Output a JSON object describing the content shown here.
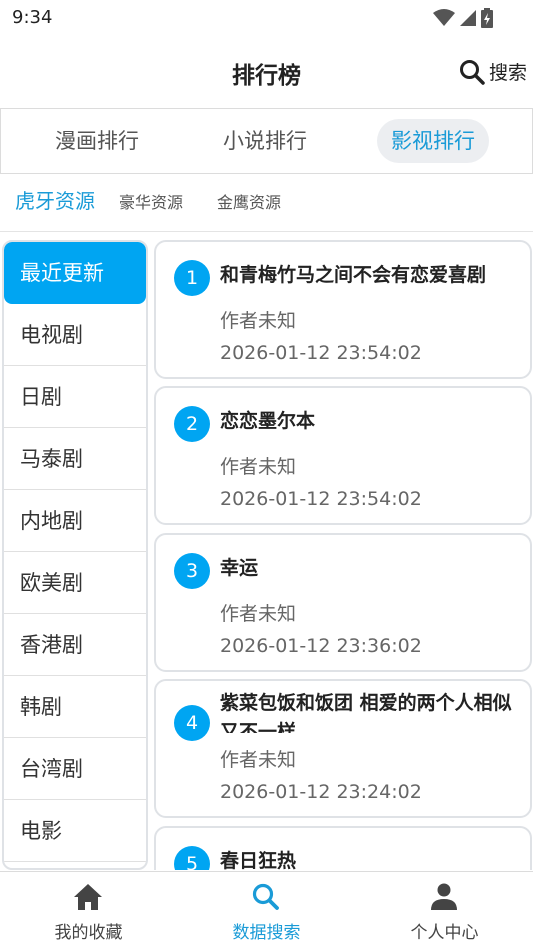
{
  "status_bar": {
    "time": "9:34"
  },
  "header": {
    "title": "排行榜",
    "search_label": "搜索"
  },
  "main_tabs": [
    {
      "label": "漫画排行",
      "active": false
    },
    {
      "label": "小说排行",
      "active": false
    },
    {
      "label": "影视排行",
      "active": true
    }
  ],
  "source_tabs": [
    {
      "label": "虎牙资源",
      "active": true
    },
    {
      "label": "豪华资源",
      "active": false
    },
    {
      "label": "金鹰资源",
      "active": false
    }
  ],
  "sidebar": {
    "items": [
      {
        "label": "最近更新",
        "active": true
      },
      {
        "label": "电视剧"
      },
      {
        "label": "日剧"
      },
      {
        "label": "马泰剧"
      },
      {
        "label": "内地剧"
      },
      {
        "label": "欧美剧"
      },
      {
        "label": "香港剧"
      },
      {
        "label": "韩剧"
      },
      {
        "label": "台湾剧"
      },
      {
        "label": "电影"
      }
    ]
  },
  "rank_list": [
    {
      "rank": "1",
      "title": "和青梅竹马之间不会有恋爱喜剧",
      "author": "作者未知",
      "time": "2026-01-12 23:54:02"
    },
    {
      "rank": "2",
      "title": "恋恋墨尔本",
      "author": "作者未知",
      "time": "2026-01-12 23:54:02"
    },
    {
      "rank": "3",
      "title": "幸运",
      "author": "作者未知",
      "time": "2026-01-12 23:36:02"
    },
    {
      "rank": "4",
      "title": "紫菜包饭和饭团 相爱的两个人相似又不一样",
      "author": "作者未知",
      "time": "2026-01-12 23:24:02"
    },
    {
      "rank": "5",
      "title": "春日狂热",
      "author": "",
      "time": ""
    }
  ],
  "bottom_nav": {
    "items": [
      {
        "label": "我的收藏",
        "icon": "home-icon",
        "active": false
      },
      {
        "label": "数据搜索",
        "icon": "search-icon",
        "active": true
      },
      {
        "label": "个人中心",
        "icon": "person-icon",
        "active": false
      }
    ]
  },
  "colors": {
    "accent": "#00a5f2",
    "accent_text": "#1a9bd7"
  }
}
